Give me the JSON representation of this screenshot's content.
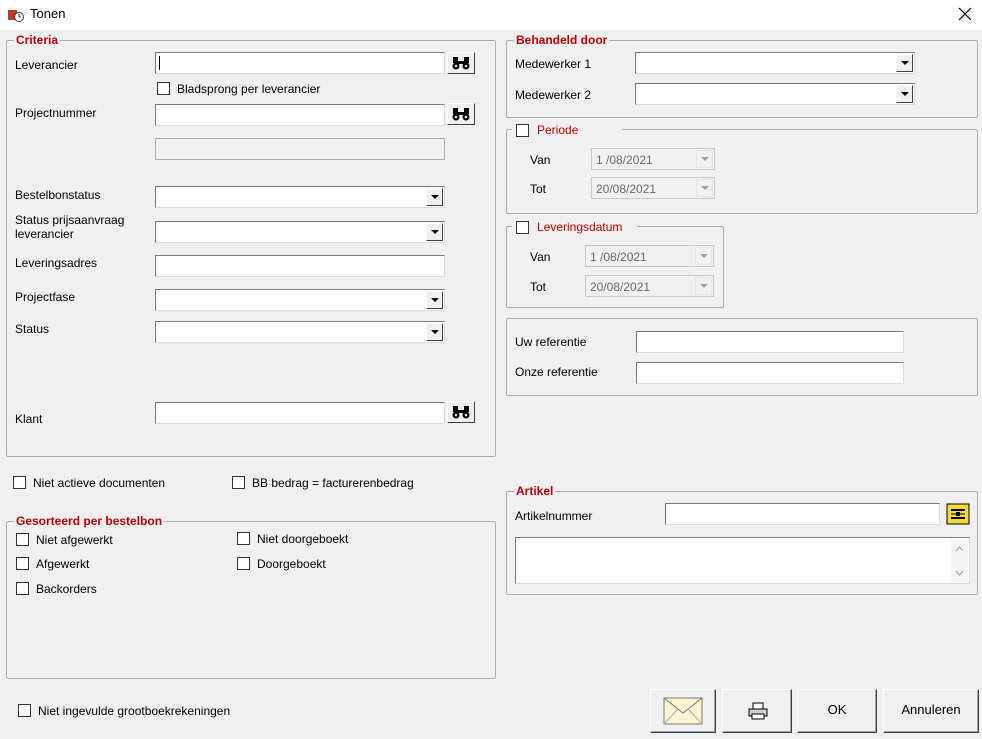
{
  "window": {
    "title": "Tonen"
  },
  "criteria": {
    "legend": "Criteria",
    "leverancier_label": "Leverancier",
    "bladsprong_label": "Bladsprong per leverancier",
    "projectnummer_label": "Projectnummer",
    "bestelbonstatus_label": "Bestelbonstatus",
    "status_prijs_label_1": "Status prijsaanvraag",
    "status_prijs_label_2": "leverancier",
    "leveringsadres_label": "Leveringsadres",
    "projectfase_label": "Projectfase",
    "status_label": "Status",
    "klant_label": "Klant"
  },
  "options": {
    "niet_actieve": "Niet actieve documenten",
    "bb_bedrag": "BB bedrag = facturerenbedrag",
    "niet_ingevulde": "Niet ingevulde grootboekrekeningen"
  },
  "gesorteerd": {
    "legend": "Gesorteerd per bestelbon",
    "niet_afgewerkt": "Niet afgewerkt",
    "afgewerkt": "Afgewerkt",
    "backorders": "Backorders",
    "niet_doorgeboekt": "Niet doorgeboekt",
    "doorgeboekt": "Doorgeboekt"
  },
  "behandeld": {
    "legend": "Behandeld door",
    "medewerker1_label": "Medewerker 1",
    "medewerker2_label": "Medewerker 2"
  },
  "periode": {
    "legend": "Periode",
    "van_label": "Van",
    "van_value": "1 /08/2021",
    "tot_label": "Tot",
    "tot_value": "20/08/2021"
  },
  "leveringsdatum": {
    "legend": "Leveringsdatum",
    "van_label": "Van",
    "van_value": "1 /08/2021",
    "tot_label": "Tot",
    "tot_value": "20/08/2021"
  },
  "referentie": {
    "uw_label": "Uw referentie",
    "onze_label": "Onze referentie"
  },
  "artikel": {
    "legend": "Artikel",
    "artikelnummer_label": "Artikelnummer"
  },
  "buttons": {
    "ok": "OK",
    "annuleren": "Annuleren"
  },
  "colors": {
    "legend": "#c00000",
    "face": "#f0f0f0"
  }
}
